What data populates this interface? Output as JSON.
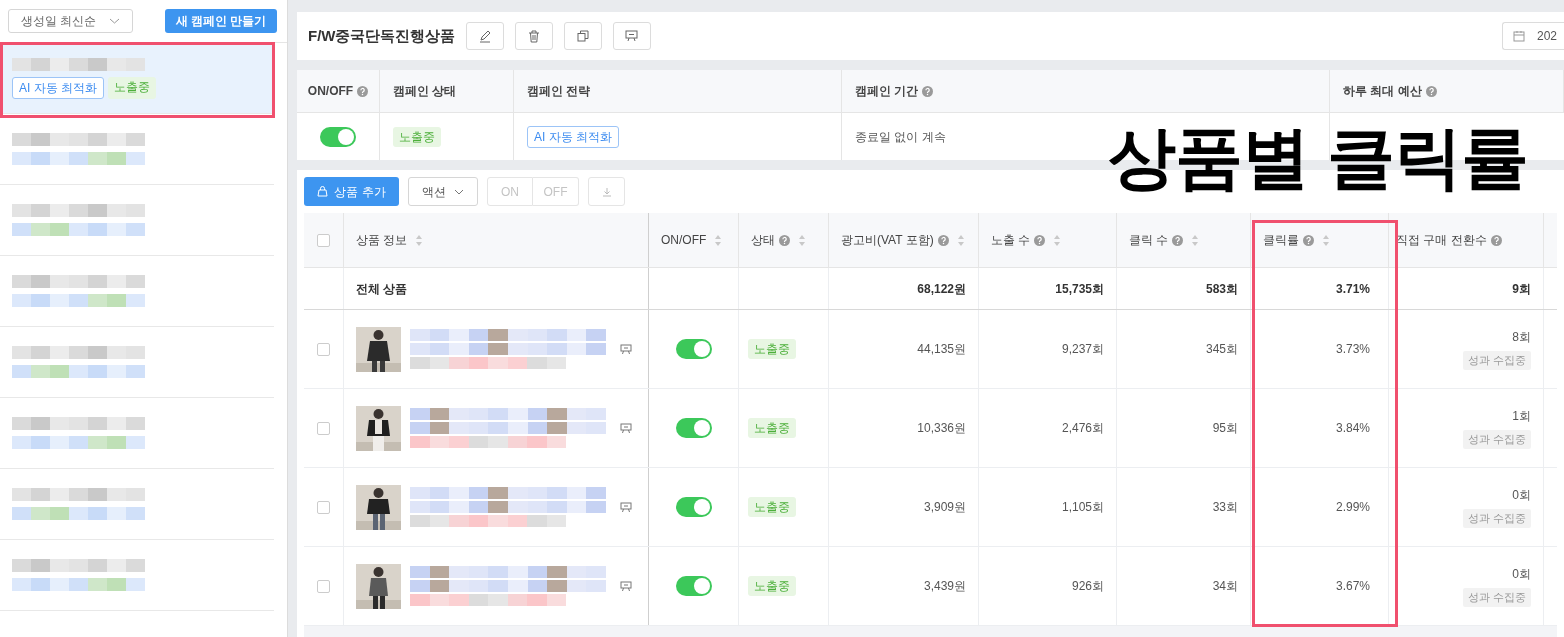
{
  "sidebar": {
    "sort_dropdown": "생성일 최신순",
    "create_button": "새 캠페인 만들기",
    "campaigns": [
      {
        "selected": true,
        "tags": [
          {
            "kind": "strategy",
            "label": "AI 자동 최적화"
          },
          {
            "kind": "status",
            "label": "노출중"
          }
        ]
      },
      {
        "selected": false
      },
      {
        "selected": false
      },
      {
        "selected": false
      },
      {
        "selected": false
      },
      {
        "selected": false
      },
      {
        "selected": false
      },
      {
        "selected": false
      }
    ]
  },
  "header": {
    "title": "F/W중국단독진행상품",
    "date_field": "202"
  },
  "campaign_info": {
    "columns": [
      {
        "label": "ON/OFF",
        "help": true
      },
      {
        "label": "캠페인 상태",
        "help": false
      },
      {
        "label": "캠페인 전략",
        "help": false
      },
      {
        "label": "캠페인 기간",
        "help": true
      },
      {
        "label": "하루 최대 예산",
        "help": true
      }
    ],
    "on": true,
    "status": "노출중",
    "strategy": "AI 자동 최적화",
    "period": "종료일 없이 계속"
  },
  "toolbar": {
    "add_button": "상품 추가",
    "action_dropdown": "액션",
    "on_button": "ON",
    "off_button": "OFF"
  },
  "table": {
    "header_checked": false,
    "columns": [
      {
        "label": "상품 정보",
        "help": false,
        "sortable": true
      },
      {
        "label": "ON/OFF",
        "help": false,
        "sortable": true
      },
      {
        "label": "상태",
        "help": true,
        "sortable": true
      },
      {
        "label": "광고비(VAT 포함)",
        "help": true,
        "sortable": true
      },
      {
        "label": "노출 수",
        "help": true,
        "sortable": true
      },
      {
        "label": "클릭 수",
        "help": true,
        "sortable": true
      },
      {
        "label": "클릭률",
        "help": true,
        "sortable": true
      },
      {
        "label": "직접 구매 전환수",
        "help": true,
        "sortable": false
      }
    ],
    "total_row": {
      "label": "전체 상품",
      "ad_cost": "68,122원",
      "impressions": "15,735회",
      "clicks": "583회",
      "ctr": "3.71%",
      "conversions": "9회"
    },
    "rows": [
      {
        "checked": false,
        "on": true,
        "status": "노출중",
        "ad_cost": "44,135원",
        "impressions": "9,237회",
        "clicks": "345회",
        "ctr": "3.73%",
        "conversions": "8회",
        "conversion_note": "성과 수집중"
      },
      {
        "checked": false,
        "on": true,
        "status": "노출중",
        "ad_cost": "10,336원",
        "impressions": "2,476회",
        "clicks": "95회",
        "ctr": "3.84%",
        "conversions": "1회",
        "conversion_note": "성과 수집중"
      },
      {
        "checked": false,
        "on": true,
        "status": "노출중",
        "ad_cost": "3,909원",
        "impressions": "1,105회",
        "clicks": "33회",
        "ctr": "2.99%",
        "conversions": "0회",
        "conversion_note": "성과 수집중"
      },
      {
        "checked": false,
        "on": true,
        "status": "노출중",
        "ad_cost": "3,439원",
        "impressions": "926회",
        "clicks": "34회",
        "ctr": "3.67%",
        "conversions": "0회",
        "conversion_note": "성과 수집중"
      }
    ]
  },
  "annotation": {
    "label": "상품별 클릭률"
  }
}
